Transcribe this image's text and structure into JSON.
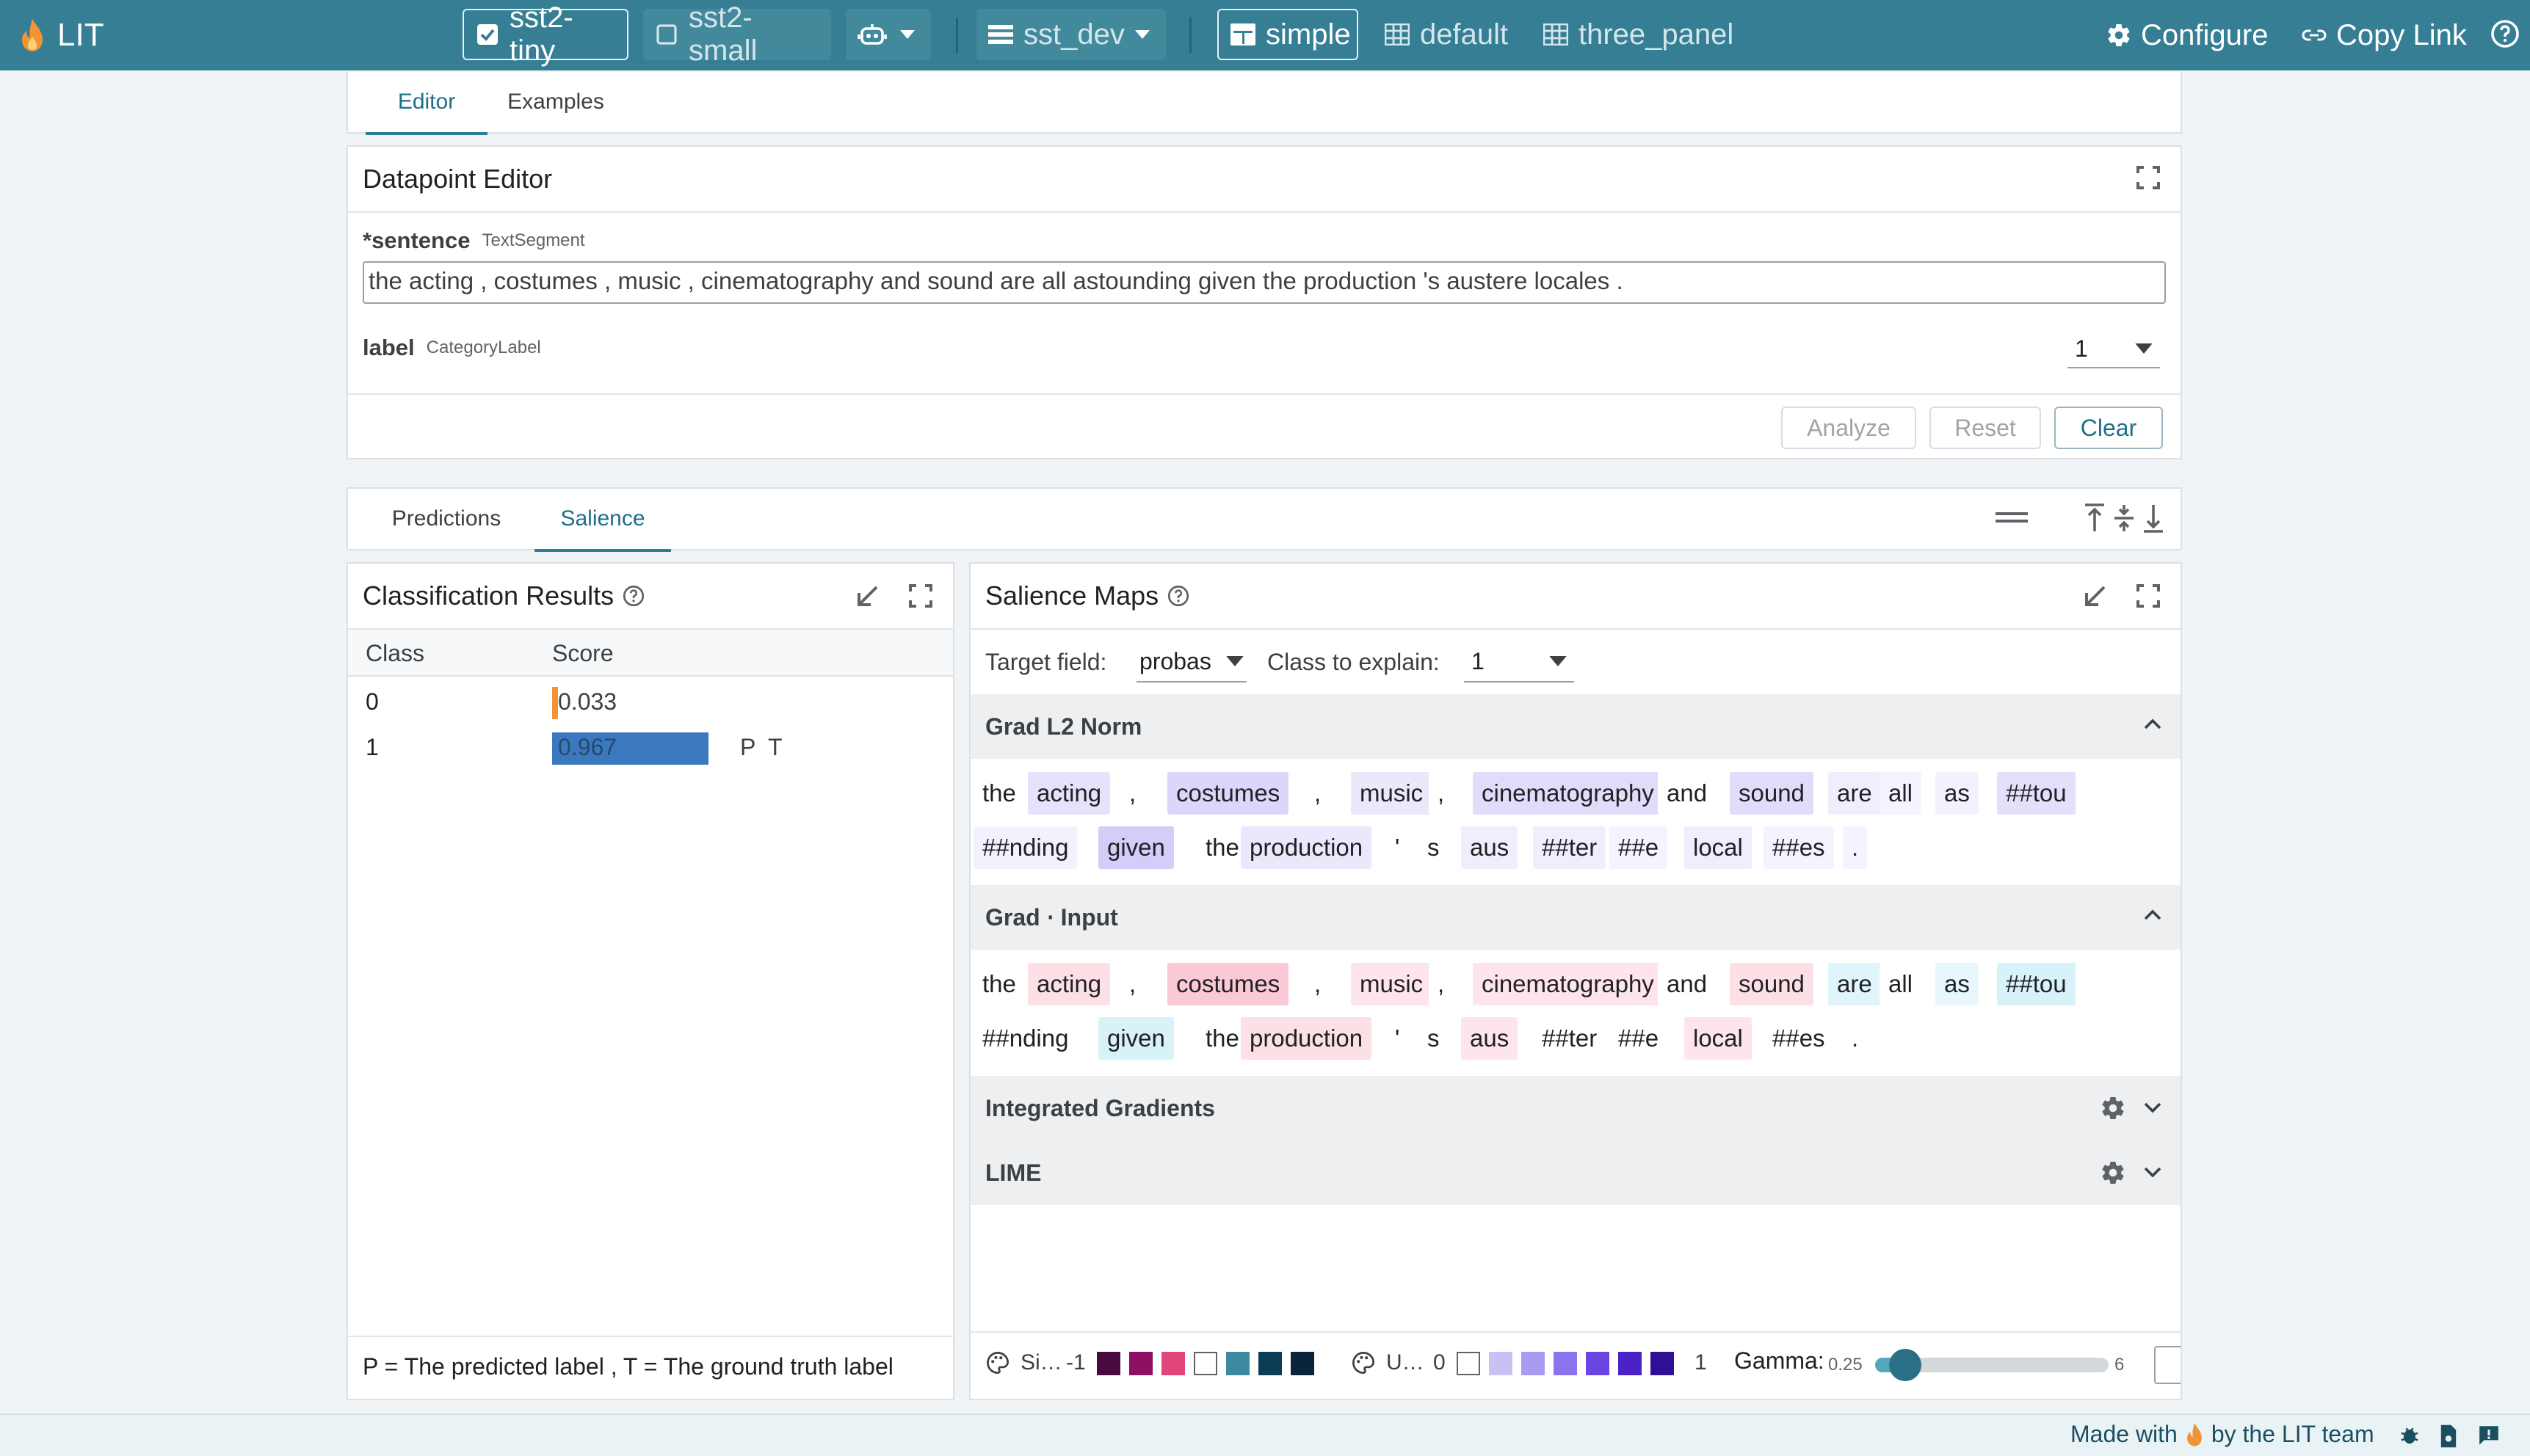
{
  "topbar": {
    "app_name": "LIT",
    "models": [
      "sst2-tiny",
      "sst2-small"
    ],
    "dataset": "sst_dev",
    "layouts": [
      "simple",
      "default",
      "three_panel"
    ],
    "configure": "Configure",
    "copy_link": "Copy Link"
  },
  "upper_tabs": [
    "Editor",
    "Examples"
  ],
  "editor": {
    "title": "Datapoint Editor",
    "sentence_label": "*sentence",
    "sentence_type": "TextSegment",
    "sentence_value": "the acting , costumes , music , cinematography and sound are all astounding given the production 's austere locales .",
    "label_label": "label",
    "label_type": "CategoryLabel",
    "label_value": "1",
    "buttons": {
      "analyze": "Analyze",
      "reset": "Reset",
      "clear": "Clear"
    }
  },
  "lower_tabs": [
    "Predictions",
    "Salience"
  ],
  "classification": {
    "title": "Classification Results",
    "columns": [
      "Class",
      "Score"
    ],
    "rows": [
      {
        "class": "0",
        "score": "0.033",
        "score_value": 0.033,
        "marks": ""
      },
      {
        "class": "1",
        "score": "0.967",
        "score_value": 0.967,
        "marks": "P  T"
      }
    ],
    "footer": "P = The predicted label , T = The ground truth label"
  },
  "salience": {
    "title": "Salience Maps",
    "target_field_label": "Target field:",
    "target_field_value": "probas",
    "class_label": "Class to explain:",
    "class_value": "1",
    "sections": [
      {
        "title": "Grad L2 Norm",
        "expanded": true
      },
      {
        "title": "Grad ⋅ Input",
        "expanded": true
      },
      {
        "title": "Integrated Gradients",
        "expanded": false
      },
      {
        "title": "LIME",
        "expanded": false
      }
    ],
    "tokens_line1": [
      "the",
      "acting",
      ",",
      "costumes",
      ",",
      "music",
      ",",
      "cinematography",
      "and",
      "sound",
      "are",
      "all",
      "as",
      "##tou"
    ],
    "tokens_line2": [
      "##nding",
      "given",
      "the",
      "production",
      "'",
      "s",
      "aus",
      "##ter",
      "##e",
      "local",
      "##es",
      "."
    ],
    "grad_l2_colors_1": [
      "#ffffff",
      "#e6e2fb",
      "#ffffff",
      "#dcd6fa",
      "#ffffff",
      "#ebe8fc",
      "#ffffff",
      "#e2dcfb",
      "#ffffff",
      "#e2dcfb",
      "#f0eefd",
      "#f5f3fe",
      "#f3f1fe",
      "#e4dffb"
    ],
    "grad_l2_colors_2": [
      "#f3f1fe",
      "#d5cdf9",
      "#ffffff",
      "#ebe8fc",
      "#ffffff",
      "#ffffff",
      "#f0eefd",
      "#f0eefd",
      "#f5f3fe",
      "#f0eefd",
      "#f5f3fe",
      "#f5f3fe"
    ],
    "grad_input_colors_1": [
      "#ffffff",
      "#fde0e6",
      "#ffffff",
      "#fbc9d5",
      "#ffffff",
      "#fde5eb",
      "#ffffff",
      "#fde5eb",
      "#ffffff",
      "#fde0e6",
      "#dff4fb",
      "#ffffff",
      "#e8f7fc",
      "#d8f2fa"
    ],
    "grad_input_colors_2": [
      "#ffffff",
      "#d8f2fa",
      "#ffffff",
      "#fde0e6",
      "#ffffff",
      "#ffffff",
      "#fde5eb",
      "#ffffff",
      "#ffffff",
      "#fde5eb",
      "#ffffff",
      "#ffffff"
    ],
    "legend": {
      "signed_label": "Si…",
      "signed_min": "-1",
      "signed_colors": [
        "#4a0a40",
        "#8e0f63",
        "#e0457b",
        "#ffffff",
        "#3d8aa0",
        "#0c3d56",
        "#08233a"
      ],
      "unsigned_label": "U…",
      "unsigned_min": "0",
      "unsigned_max": "1",
      "unsigned_colors": [
        "#ffffff",
        "#c9c1f4",
        "#a99cf0",
        "#8a73ec",
        "#6a45e0",
        "#4b22c6",
        "#2f0f96"
      ],
      "gamma_label": "Gamma:",
      "gamma_min": "0.25",
      "gamma_max": "6",
      "gamma_value": 1.0
    }
  },
  "footer": {
    "made_with": "Made with",
    "by": "by the LIT team"
  }
}
